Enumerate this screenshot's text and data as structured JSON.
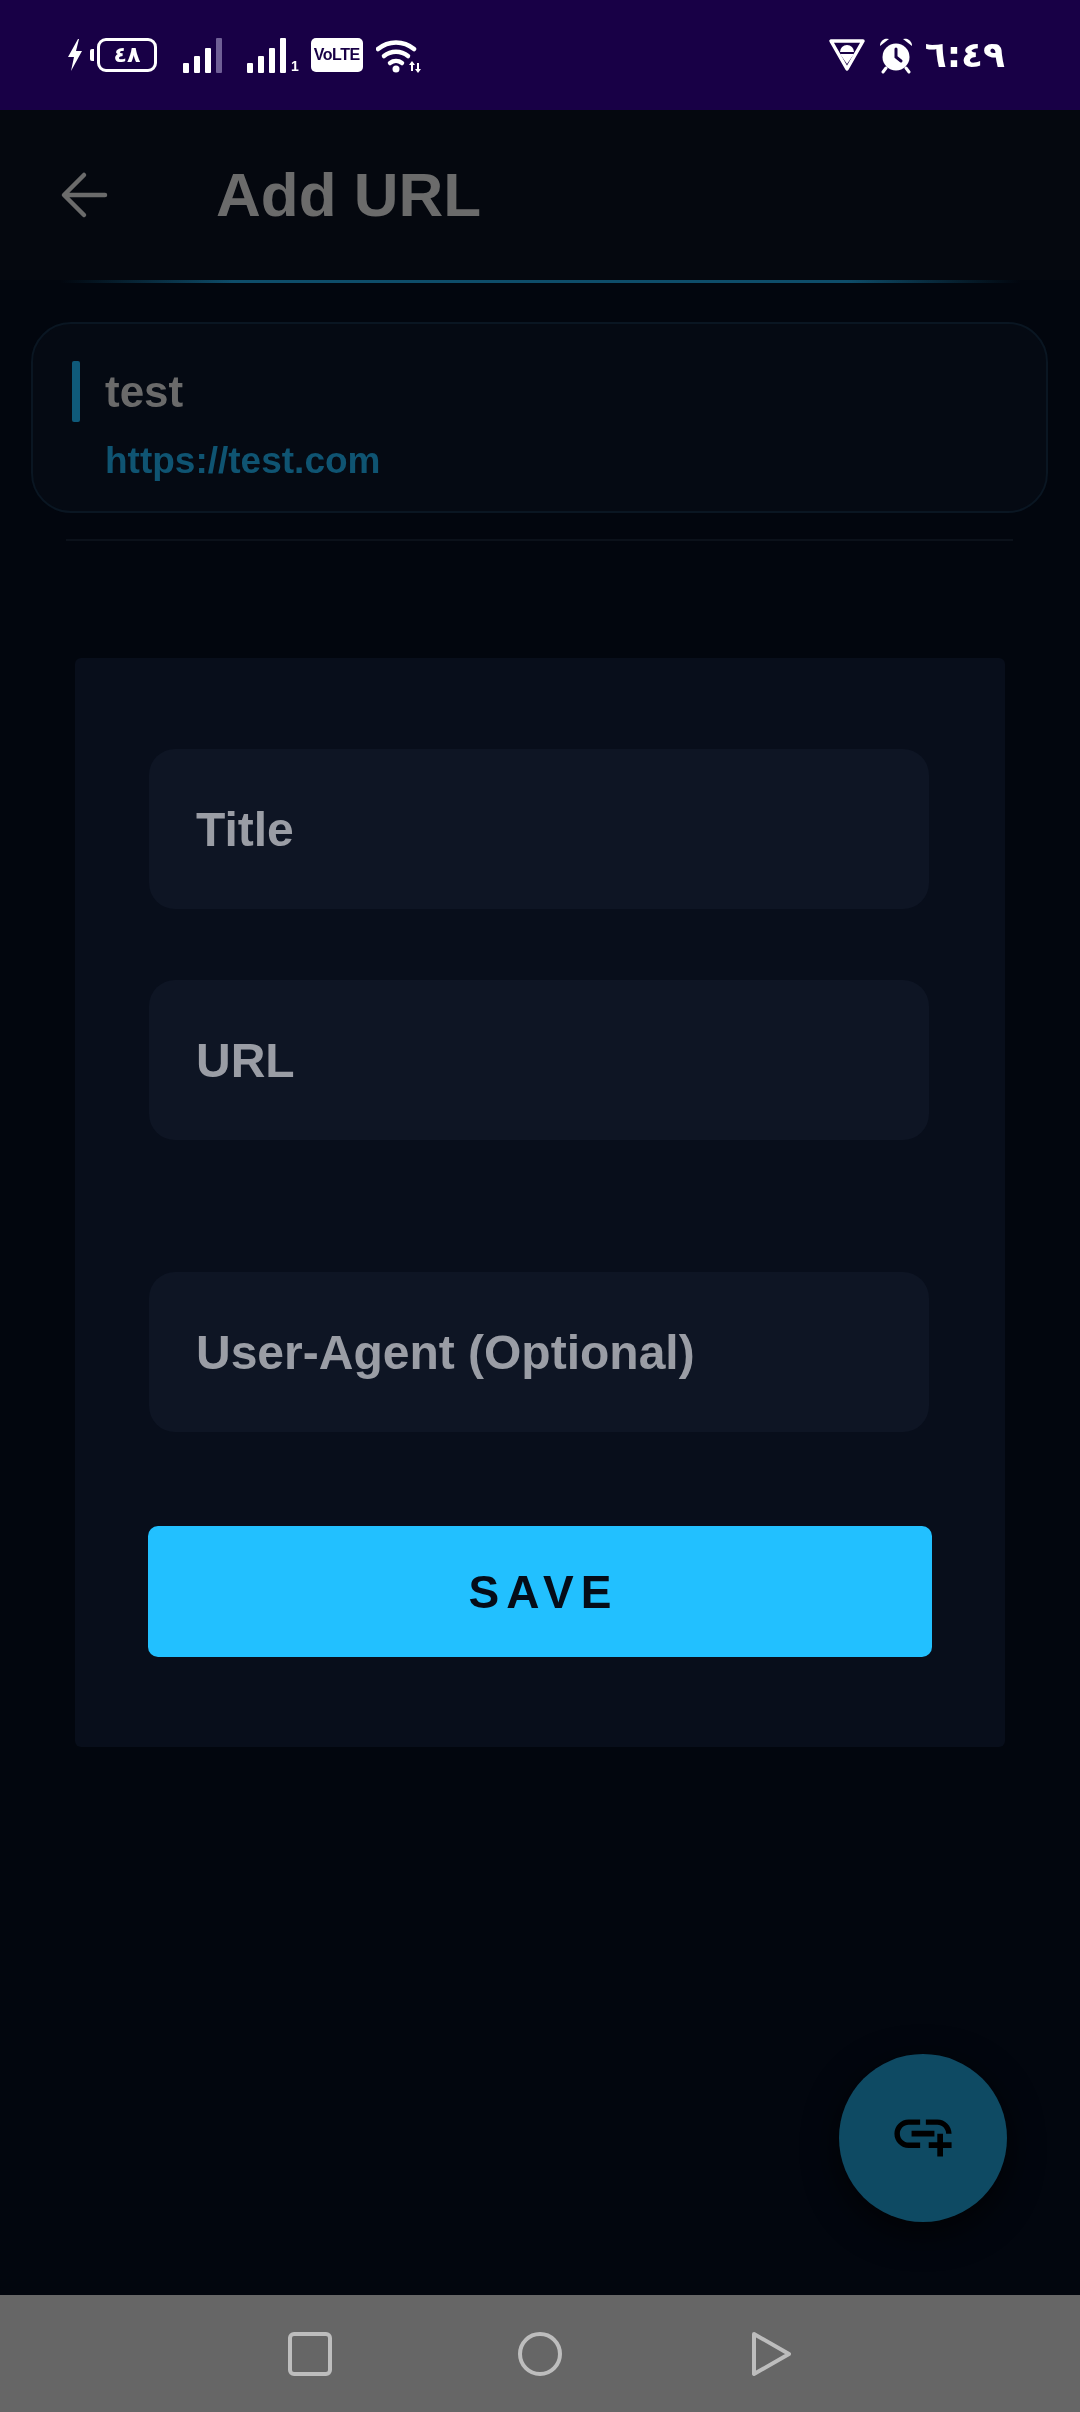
{
  "status_bar": {
    "battery": "٤٨",
    "sim_label": "1",
    "network_badge": "VoLTE",
    "time": "٦:٤٩"
  },
  "app_bar": {
    "title": "Add URL"
  },
  "saved_urls": [
    {
      "title": "test",
      "url": "https://test.com"
    }
  ],
  "dialog": {
    "fields": [
      {
        "placeholder": "Title"
      },
      {
        "placeholder": "URL"
      },
      {
        "placeholder": "User-Agent (Optional)"
      }
    ],
    "button": "SAVE"
  }
}
